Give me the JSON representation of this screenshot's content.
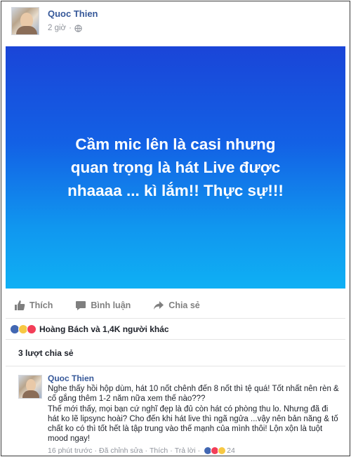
{
  "post": {
    "author": "Quoc Thien",
    "time": "2 giờ",
    "dot": "·",
    "privacy_icon": "globe-icon",
    "status_text": "Cầm mic lên  là casi nhưng quan trọng là hát Live được nhaaaa ... kì lắm!! Thực sự!!!",
    "card_colors": {
      "top": "#1a45d8",
      "bottom": "#0fb0f4"
    }
  },
  "actions": {
    "like_label": "Thích",
    "comment_label": "Bình luận",
    "share_label": "Chia sẻ"
  },
  "reactions": {
    "icons": [
      "like-icon",
      "haha-icon",
      "love-icon"
    ],
    "summary": "Hoàng Bách và 1,4K người khác"
  },
  "shares": {
    "label": "3 lượt chia sẻ"
  },
  "comment": {
    "author": "Quoc Thien",
    "text_1": "Nghe thấy hồi hộp dùm, hát 10 nốt chênh đến 8 nốt thì tệ quá! Tốt nhất nên rèn & cố gắng thêm 1-2 năm nữa xem thế nào???",
    "text_2": "Thế mới thấy, mọi bạn cứ nghĩ đẹp là đủ còn hát có phòng thu lo. Nhưng đã đi hát ko lẽ lipsync hoài? Cho đến khi hát live thì ngã ngửa ...vậy nên bản năng & tố chất ko có thì tốt hết là tập trung vào thế mạnh của mình thôi! Lộn xộn là tuột mood ngay!",
    "time": "16 phút trước",
    "edited": "Đã chỉnh sửa",
    "like": "Thích",
    "reply": "Trả lời",
    "sep": "·",
    "reaction_count": "24"
  },
  "colors": {
    "accent": "#365899",
    "muted": "#90949c"
  }
}
